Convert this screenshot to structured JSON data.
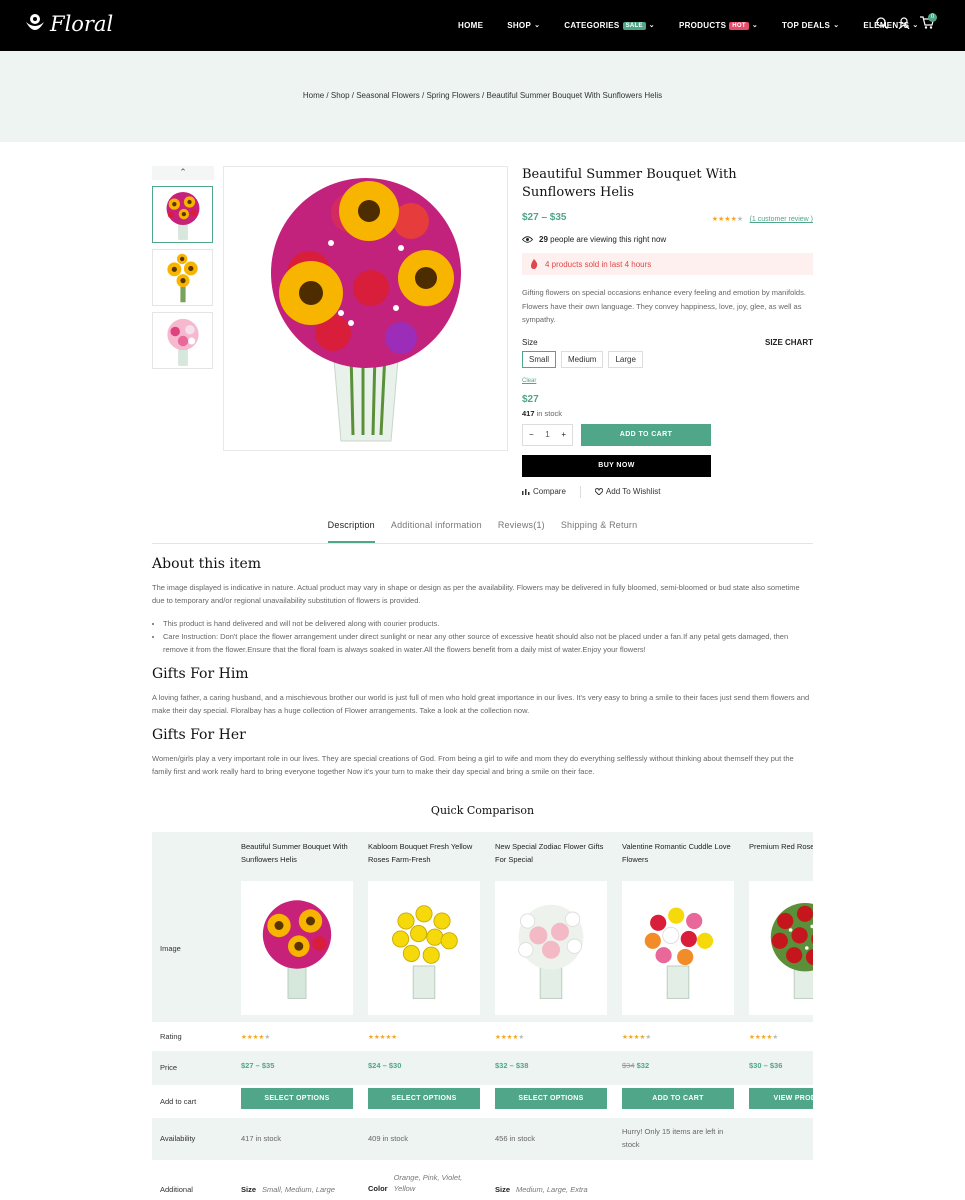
{
  "header": {
    "logo": "Floral",
    "nav": [
      {
        "label": "HOME",
        "chevron": false,
        "badge": ""
      },
      {
        "label": "SHOP",
        "chevron": true,
        "badge": ""
      },
      {
        "label": "CATEGORIES",
        "chevron": true,
        "badge": "SALE",
        "badge_color": "#4fa688"
      },
      {
        "label": "PRODUCTS",
        "chevron": true,
        "badge": "HOT",
        "badge_color": "#e94b6b"
      },
      {
        "label": "TOP DEALS",
        "chevron": true,
        "badge": ""
      },
      {
        "label": "ELEMENTS",
        "chevron": true,
        "badge": ""
      }
    ],
    "cart_count": "0",
    "icons": [
      "search-icon",
      "user-icon",
      "cart-icon"
    ]
  },
  "breadcrumb": "Home / Shop / Seasonal Flowers / Spring Flowers / Beautiful Summer Bouquet With Sunflowers Helis",
  "product": {
    "title": "Beautiful Summer Bouquet With Sunflowers Helis",
    "price_range": "$27 – $35",
    "rating": 4,
    "review_link": "(1 customer review )",
    "viewing_count": "29",
    "viewing_text": "people are viewing this right now",
    "sold_text": "4 products sold in last 4 hours",
    "description": "Gifting flowers on special occasions enhance every feeling and emotion by manifolds. Flowers have their own language. They convey happiness, love, joy, glee, as well as sympathy.",
    "size_label": "Size",
    "size_chart": "SIZE CHART",
    "sizes": [
      "Small",
      "Medium",
      "Large"
    ],
    "selected_size": "Small",
    "clear": "Clear",
    "selected_price": "$27",
    "stock_count": "417",
    "stock_text": "in stock",
    "qty": "1",
    "qty_minus": "−",
    "qty_plus": "+",
    "add_to_cart": "ADD TO CART",
    "buy_now": "BUY NOW",
    "compare": "Compare",
    "wishlist": "Add To Wishlist"
  },
  "tabs": [
    "Description",
    "Additional information",
    "Reviews(1)",
    "Shipping & Return"
  ],
  "description": {
    "about_title": "About this item",
    "about_text": "The image displayed is indicative in nature. Actual product may vary in shape or design as per the availability. Flowers may be delivered in fully bloomed, semi-bloomed or bud state also sometime due to temporary and/or regional unavailability substitution of flowers is provided.",
    "bullets": [
      "This product is hand delivered and will not be delivered along with courier products.",
      "Care Instruction: Don't place the flower arrangement under direct sunlight or near any other source of excessive heatit should also not be placed under a fan.If any petal gets damaged, then remove it from the flower.Ensure that the floral foam is always soaked in water.All the flowers benefit from a daily mist of water.Enjoy your flowers!"
    ],
    "him_title": "Gifts For Him",
    "him_text": "A loving father, a caring husband, and a mischievous brother our world is just full of men who hold great importance in our lives. It's very easy to bring a smile to their faces just send them flowers and make their day special. Floralbay has a huge collection of Flower arrangements. Take a look at the collection now.",
    "her_title": "Gifts For Her",
    "her_text": "Women/girls play a very important role in our lives. They are special creations of God. From being a girl to wife and mom they do everything selflessly without thinking about themself they put the family first and work really hard to bring everyone together Now it's your turn to make their day special and bring a smile on their face."
  },
  "comparison": {
    "title": "Quick Comparison",
    "row_labels": {
      "image": "Image",
      "rating": "Rating",
      "price": "Price",
      "cart": "Add to cart",
      "availability": "Availability",
      "additional": "Additional"
    },
    "products": [
      {
        "name": "Beautiful Summer Bouquet With Sunflowers Helis",
        "rating": 4,
        "price": "$27 – $35",
        "old_price": "",
        "button": "SELECT OPTIONS",
        "availability": "417 in stock",
        "attr_label": "Size",
        "attr_value": "Small, Medium, Large",
        "image": "sunflower-bouquet"
      },
      {
        "name": "Kabloom Bouquet Fresh Yellow Roses Farm-Fresh",
        "rating": 5,
        "price": "$24 – $30",
        "old_price": "",
        "button": "SELECT OPTIONS",
        "availability": "409 in stock",
        "attr_label": "Color",
        "attr_value": "Orange, Pink, Violet, Yellow",
        "image": "yellow-roses"
      },
      {
        "name": "New Special Zodiac Flower Gifts For Special",
        "rating": 4,
        "price": "$32 – $38",
        "old_price": "",
        "button": "SELECT OPTIONS",
        "availability": "456 in stock",
        "attr_label": "Size",
        "attr_value": "Medium, Large, Extra",
        "image": "lily-bouquet"
      },
      {
        "name": "Valentine Romantic Cuddle Love Flowers",
        "rating": 4,
        "price": "$32",
        "old_price": "$34",
        "button": "ADD TO CART",
        "availability": "Hurry! Only 15 items are left in stock",
        "attr_label": "",
        "attr_value": "",
        "image": "mixed-roses"
      },
      {
        "name": "Premium Red Roses With Bowl",
        "rating": 4,
        "price": "$30 – $36",
        "old_price": "",
        "button": "VIEW PRODUCTS",
        "availability": "",
        "attr_label": "",
        "attr_value": "",
        "image": "red-roses"
      }
    ]
  },
  "colors": {
    "accent": "#4fa688",
    "header_bg": "#000000",
    "band_bg": "#eef4f1",
    "alert": "#e0474c",
    "star": "#f5a623"
  }
}
